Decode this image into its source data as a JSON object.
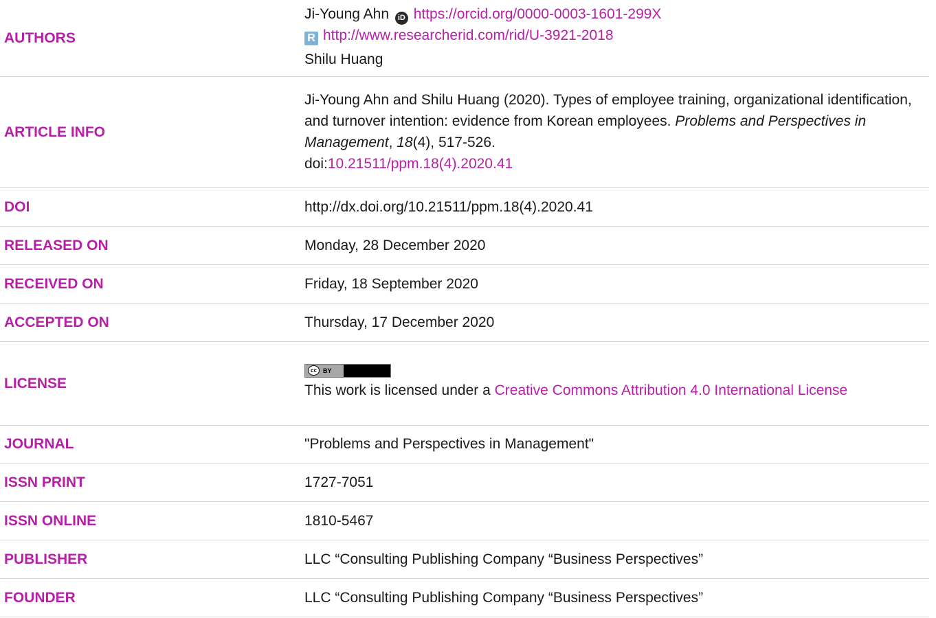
{
  "authors": {
    "label": "AUTHORS",
    "author1": "Ji-Young Ahn",
    "orcid_url": "https://orcid.org/0000-0003-1601-299X",
    "orcid_icon_text": "iD",
    "rid_icon_text": "R",
    "rid_url": "http://www.researcherid.com/rid/U-3921-2018",
    "author2": "Shilu Huang"
  },
  "article_info": {
    "label": "ARTICLE INFO",
    "citation_prefix": "Ji-Young Ahn and Shilu Huang (2020). Types of employee training, organizational identification, and turnover intention: evidence from Korean employees. ",
    "journal_italic": "Problems and Perspectives in Management",
    "sep1": ", ",
    "volume_italic": "18",
    "issue_pages": "(4), 517-526.",
    "doi_prefix": "doi:",
    "doi_link": "10.21511/ppm.18(4).2020.41"
  },
  "doi": {
    "label": "DOI",
    "value": "http://dx.doi.org/10.21511/ppm.18(4).2020.41"
  },
  "released_on": {
    "label": "RELEASED ON",
    "value": "Monday, 28 December 2020"
  },
  "received_on": {
    "label": "RECEIVED ON",
    "value": "Friday, 18 September 2020"
  },
  "accepted_on": {
    "label": "ACCEPTED ON",
    "value": "Thursday, 17 December 2020"
  },
  "license": {
    "label": "LICENSE",
    "badge_cc": "cc",
    "badge_by": "BY",
    "text_prefix": "This work is licensed under a ",
    "link_text": "Creative Commons Attribution 4.0 International License"
  },
  "journal": {
    "label": "JOURNAL",
    "value": "\"Problems and Perspectives in Management\""
  },
  "issn_print": {
    "label": "ISSN PRINT",
    "value": "1727-7051"
  },
  "issn_online": {
    "label": "ISSN ONLINE",
    "value": "1810-5467"
  },
  "publisher": {
    "label": "PUBLISHER",
    "value": "LLC “Consulting Publishing Company “Business Perspectives”"
  },
  "founder": {
    "label": "FOUNDER",
    "value": "LLC “Consulting Publishing Company “Business Perspectives”"
  },
  "colors": {
    "accent": "#b71fa8",
    "text": "#1a1a1a",
    "divider": "#d6d6d6"
  }
}
